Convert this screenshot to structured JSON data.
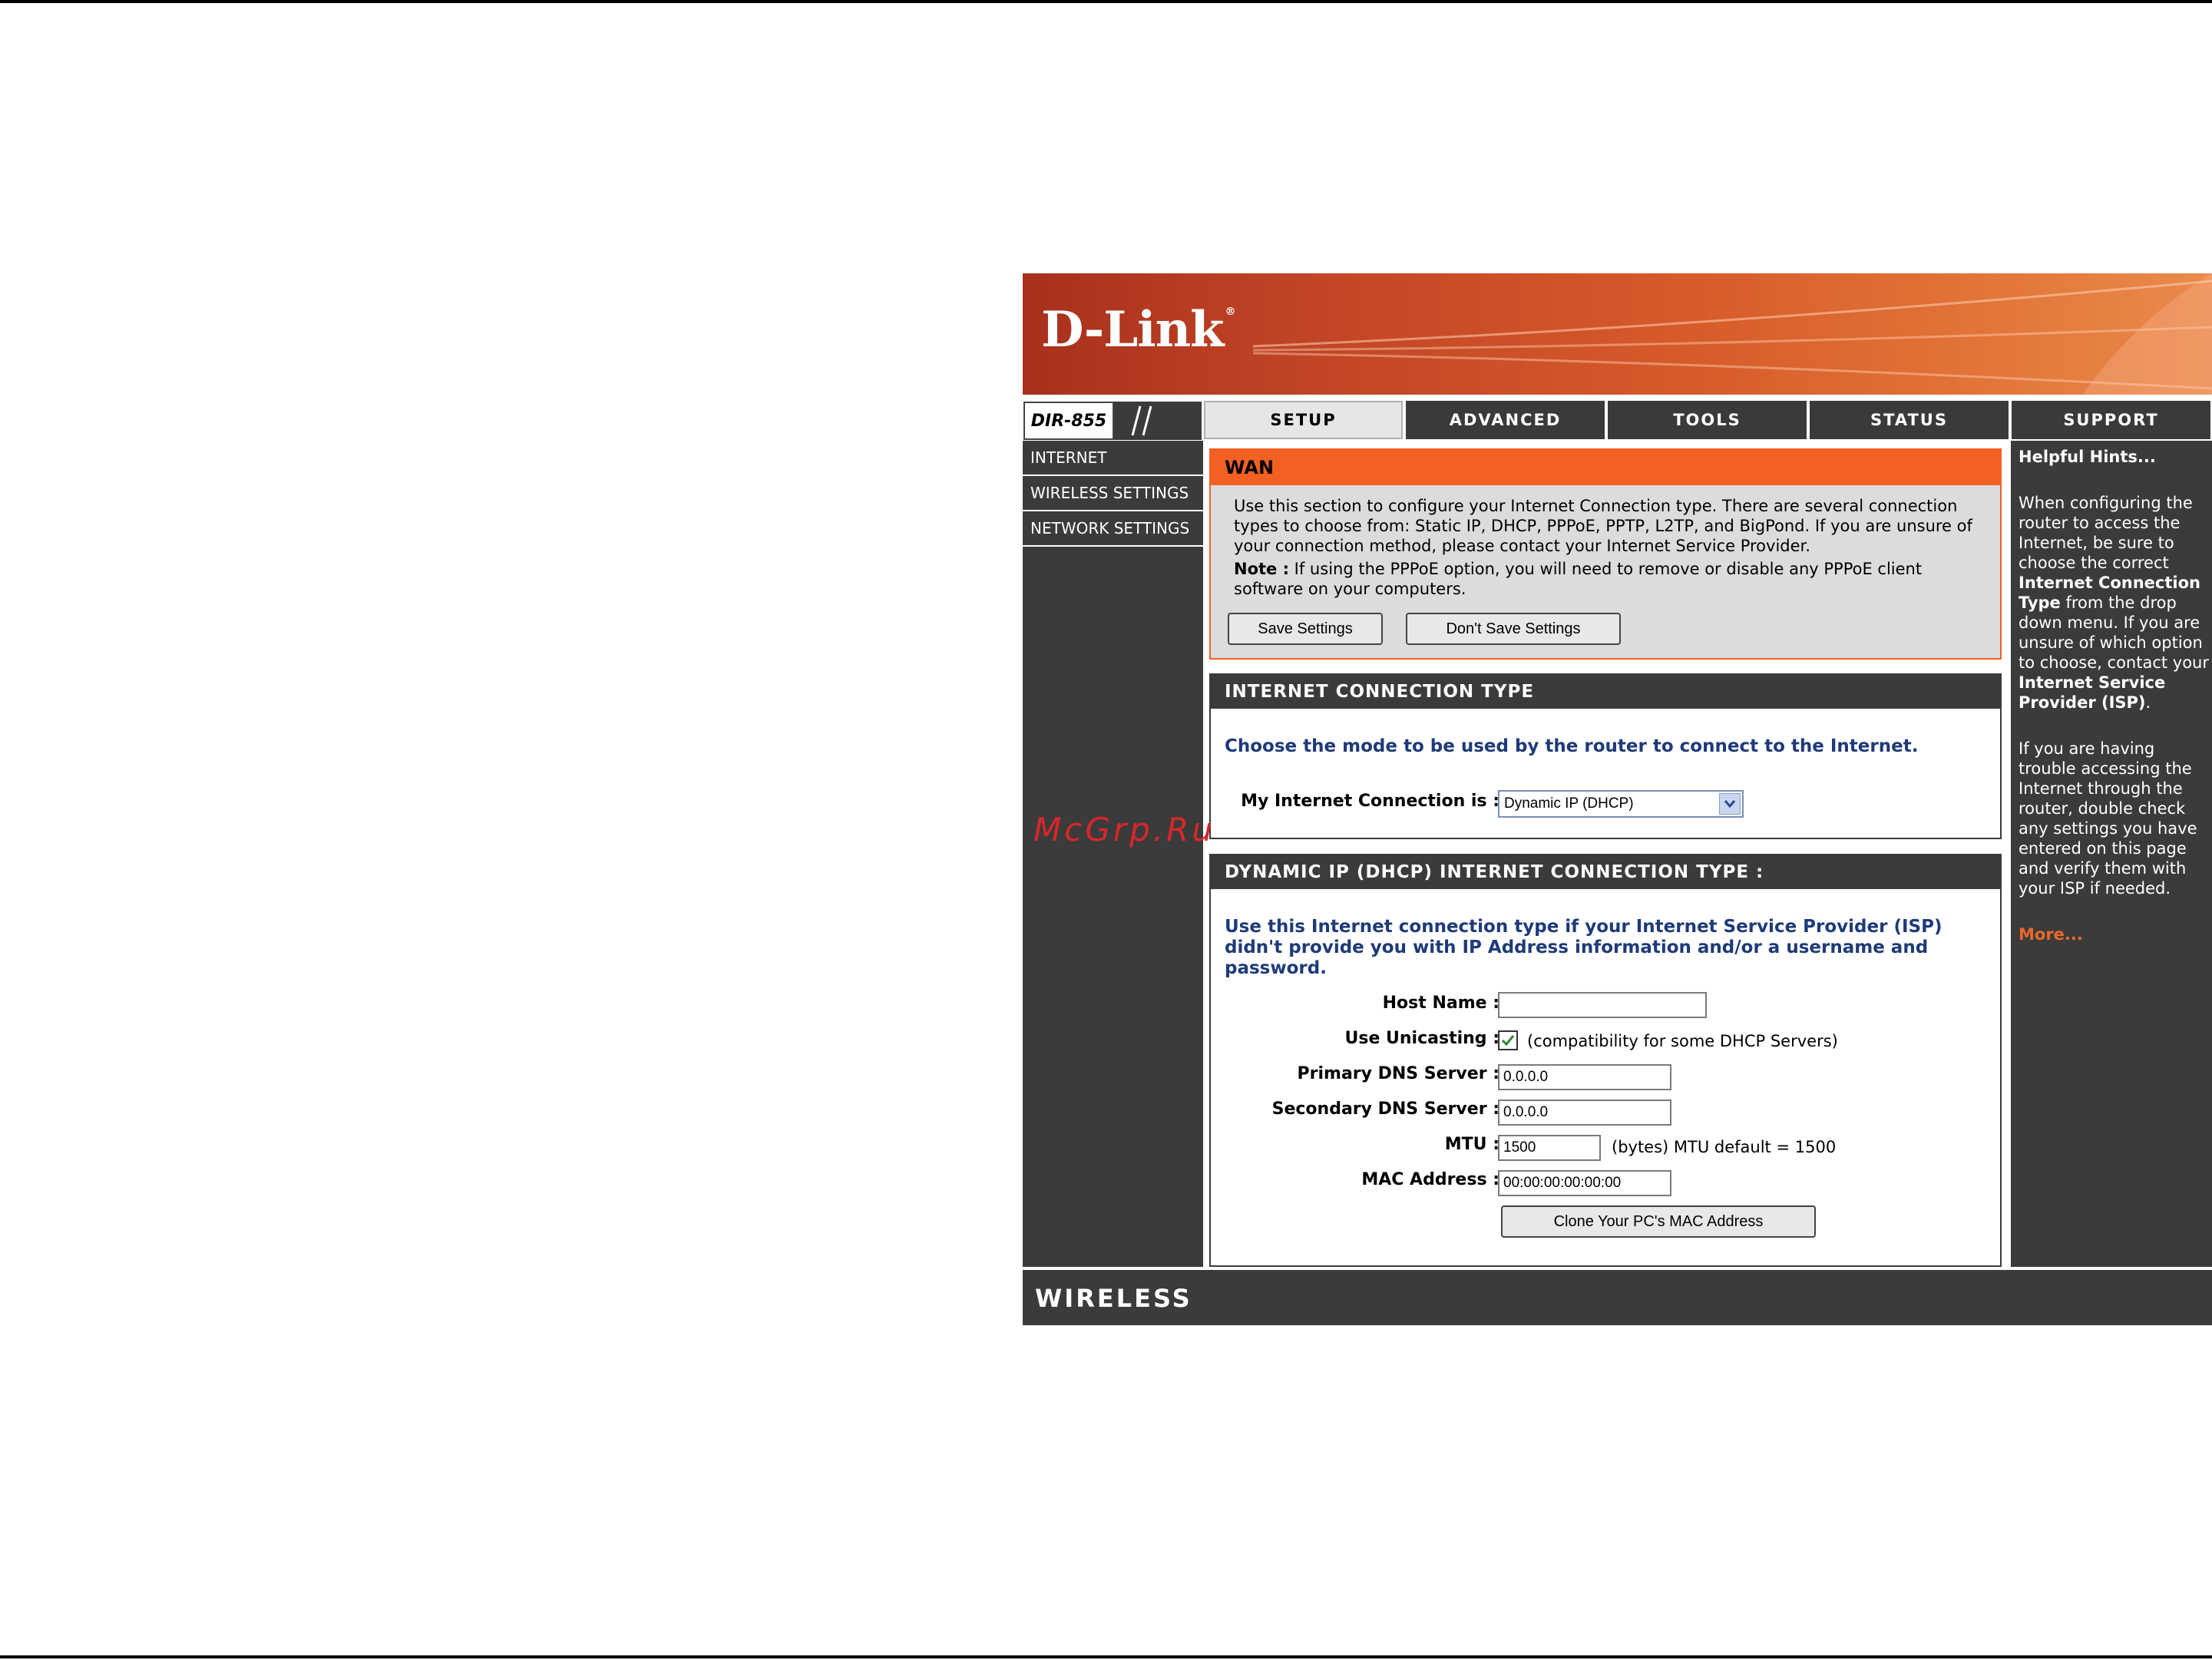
{
  "watermark": "McGrp.Ru",
  "brand": {
    "logo": "D-Link",
    "registered": "®",
    "model": "DIR-855"
  },
  "tabs": [
    "SETUP",
    "ADVANCED",
    "TOOLS",
    "STATUS",
    "SUPPORT"
  ],
  "active_tab": "SETUP",
  "sidebar": {
    "items": [
      "INTERNET",
      "WIRELESS SETTINGS",
      "NETWORK SETTINGS"
    ]
  },
  "wan": {
    "title": "WAN",
    "description": "Use this section to configure your Internet Connection type. There are several connection types to choose from: Static IP, DHCP, PPPoE, PPTP, L2TP, and BigPond. If you are unsure of your connection method, please contact your Internet Service Provider.",
    "note_label": "Note :",
    "note_text": " If using the PPPoE option, you will need to remove or disable any PPPoE client software on your computers.",
    "save_label": "Save Settings",
    "dont_save_label": "Don't Save Settings"
  },
  "connection_type": {
    "title": "INTERNET CONNECTION TYPE",
    "prompt": "Choose the mode to be used by the router to connect to the Internet.",
    "label": "My Internet Connection is :",
    "selected": "Dynamic IP (DHCP)"
  },
  "dhcp": {
    "title": "DYNAMIC IP (DHCP) INTERNET CONNECTION TYPE :",
    "intro": "Use this Internet connection type if your Internet Service Provider (ISP) didn't provide you with IP Address information and/or a username and password.",
    "host_name_label": "Host Name :",
    "host_name_value": "",
    "unicasting_label": "Use Unicasting :",
    "unicasting_checked": true,
    "unicasting_note": "(compatibility for some DHCP Servers)",
    "primary_dns_label": "Primary DNS Server :",
    "primary_dns_value": "0.0.0.0",
    "secondary_dns_label": "Secondary DNS Server :",
    "secondary_dns_value": "0.0.0.0",
    "mtu_label": "MTU :",
    "mtu_value": "1500",
    "mtu_note": "(bytes) MTU default = 1500",
    "mac_label": "MAC Address :",
    "mac_value": "00:00:00:00:00:00",
    "clone_label": "Clone Your PC's MAC Address"
  },
  "hints": {
    "title": "Helpful Hints...",
    "p1_a": "When configuring the router to access the Internet, be sure to choose the correct ",
    "p1_b": "Internet Connection Type",
    "p1_c": " from the drop down menu. If you are unsure of which option to choose, contact your ",
    "p1_d": "Internet Service Provider (ISP)",
    "p1_e": ".",
    "p2": "If you are having trouble accessing the Internet through the router, double check any settings you have entered on this page and verify them with your ISP if needed.",
    "more": "More..."
  },
  "footer": {
    "label": "WIRELESS"
  },
  "colors": {
    "accent": "#f26122",
    "dark": "#3b3b3b",
    "prompt_blue": "#1e3a78"
  }
}
